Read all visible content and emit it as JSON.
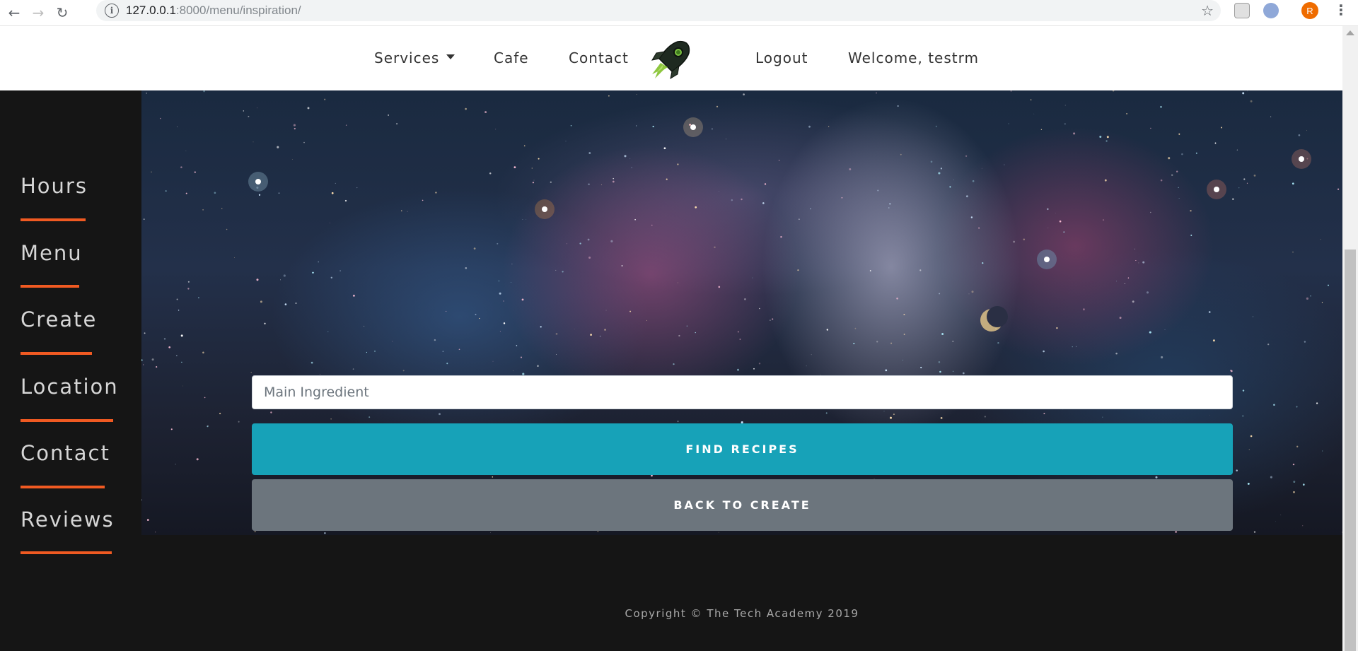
{
  "browser": {
    "url_host": "127.0.0.1",
    "url_rest": ":8000/menu/inspiration/",
    "profile_initial": "R"
  },
  "navbar": {
    "services": "Services",
    "cafe": "Cafe",
    "contact": "Contact",
    "logout": "Logout",
    "welcome": "Welcome, testrm"
  },
  "sidebar": {
    "items": [
      {
        "label": "Hours"
      },
      {
        "label": "Menu"
      },
      {
        "label": "Create"
      },
      {
        "label": "Location"
      },
      {
        "label": "Contact"
      },
      {
        "label": "Reviews"
      }
    ]
  },
  "form": {
    "placeholder": "Main Ingredient",
    "find_label": "FIND RECIPES",
    "back_label": "BACK TO CREATE"
  },
  "footer": {
    "copyright": "Copyright © The Tech Academy 2019"
  },
  "colors": {
    "accent": "#f05a22",
    "find_button": "#17a2b8",
    "back_button": "#6c757d"
  }
}
